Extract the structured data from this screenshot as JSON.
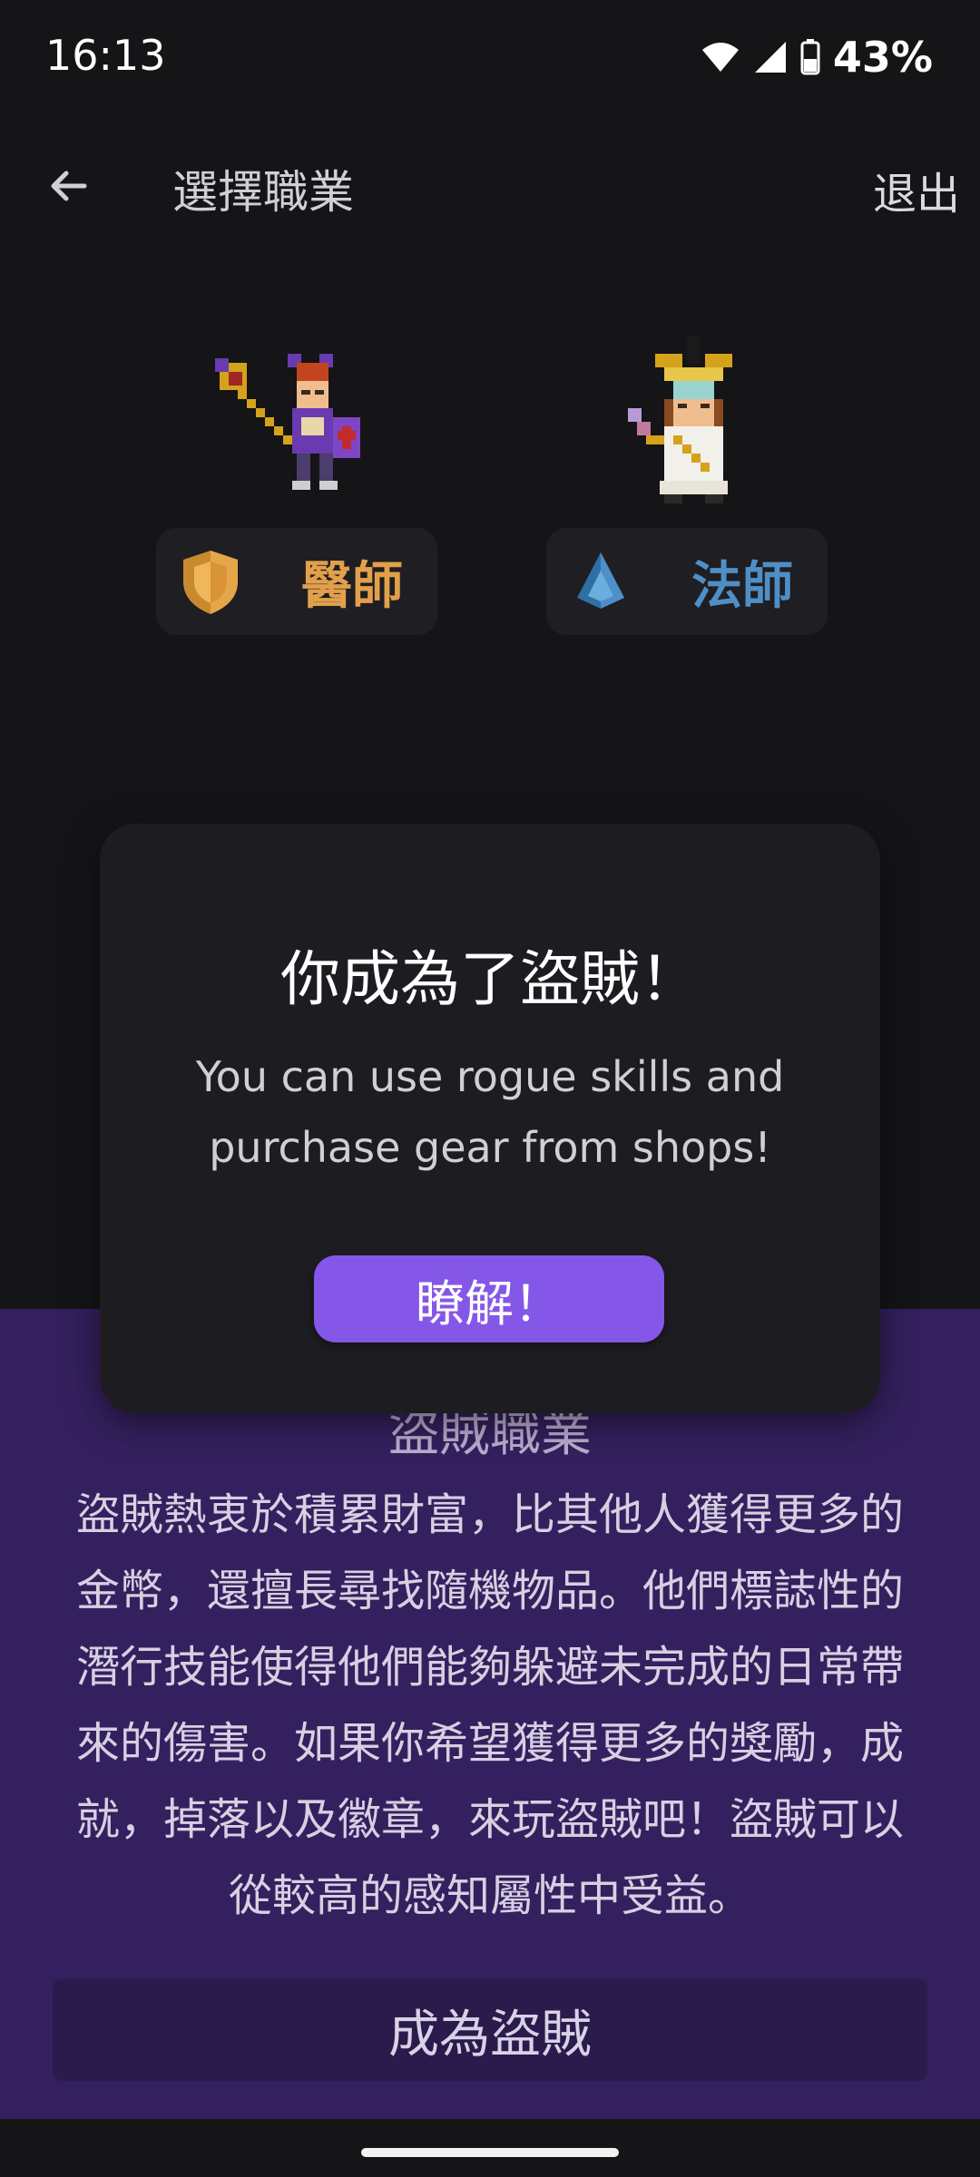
{
  "status_bar": {
    "time": "16:13",
    "battery_text": "43%",
    "icons": [
      "wifi-icon",
      "signal-icon",
      "battery-icon"
    ]
  },
  "app_bar": {
    "title": "選擇職業",
    "exit_label": "退出",
    "back_icon": "arrow-back-icon"
  },
  "classes": [
    {
      "label": "醫師",
      "icon": "shield-icon",
      "color": "#e2a04b"
    },
    {
      "label": "法師",
      "icon": "crystal-icon",
      "color": "#4e8fc7"
    }
  ],
  "panel": {
    "title": "盜賊職業",
    "description": "盜賊熱衷於積累財富，比其他人獲得更多的金幣，還擅長尋找隨機物品。他們標誌性的潛行技能使得他們能夠躲避未完成的日常帶來的傷害。如果你希望獲得更多的獎勵，成就，掉落以及徽章，來玩盜賊吧！盜賊可以從較高的感知屬性中受益。",
    "button_label": "成為盜賊",
    "background": "#34205e"
  },
  "dialog": {
    "title": "你成為了盜賊！",
    "body": "You can use rogue skills and purchase gear from shops!",
    "ok_label": "瞭解！",
    "accent": "#8557e8"
  }
}
